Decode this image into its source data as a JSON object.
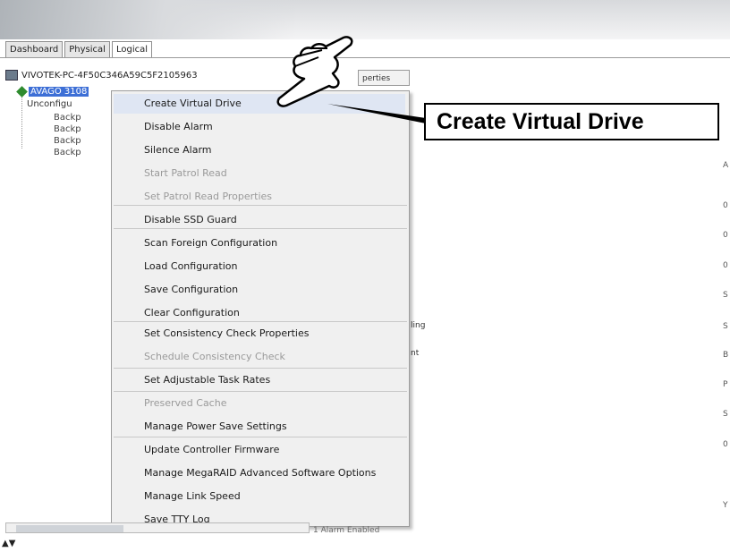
{
  "tabs": [
    "Dashboard",
    "Physical",
    "Logical"
  ],
  "tree": {
    "host": "VIVOTEK-PC-4F50C346A59C5F2105963",
    "selected_controller": "AVAGO 3108",
    "unconfigured": "Unconfigu",
    "backplanes": [
      "Backp",
      "Backp",
      "Backp",
      "Backp"
    ],
    "properties_tab": "perties"
  },
  "right_column": [
    "A",
    "0",
    "0",
    "0",
    "S",
    "S",
    "B",
    "P",
    "S",
    "0",
    "Y"
  ],
  "partial_labels": [
    "ling",
    "nt"
  ],
  "bottom_text": "1 Alarm Enabled",
  "menu": {
    "items": [
      {
        "label": "Create Virtual Drive",
        "enabled": true
      },
      {
        "label": "Disable Alarm",
        "enabled": true
      },
      {
        "label": "Silence Alarm",
        "enabled": true
      },
      {
        "label": "Start Patrol Read",
        "enabled": false
      },
      {
        "label": "Set Patrol Read Properties",
        "enabled": false
      },
      {
        "label": "Disable SSD Guard",
        "enabled": true
      },
      {
        "label": "Scan Foreign Configuration",
        "enabled": true
      },
      {
        "label": "Load Configuration",
        "enabled": true
      },
      {
        "label": "Save Configuration",
        "enabled": true
      },
      {
        "label": "Clear Configuration",
        "enabled": true
      },
      {
        "label": "Set Consistency Check Properties",
        "enabled": true
      },
      {
        "label": "Schedule Consistency Check",
        "enabled": false
      },
      {
        "label": "Set Adjustable Task Rates",
        "enabled": true
      },
      {
        "label": "Preserved Cache",
        "enabled": false
      },
      {
        "label": "Manage Power Save Settings",
        "enabled": true
      },
      {
        "label": "Update Controller Firmware",
        "enabled": true
      },
      {
        "label": "Manage MegaRAID Advanced Software Options",
        "enabled": true
      },
      {
        "label": "Manage Link Speed",
        "enabled": true
      },
      {
        "label": "Save TTY Log",
        "enabled": true
      }
    ]
  },
  "callout": {
    "text": "Create Virtual Drive"
  },
  "icons": {
    "hand": "pointing-hand-icon",
    "host": "computer-icon",
    "controller": "controller-icon"
  },
  "colors": {
    "selection": "#3d6fd6",
    "controller_icon": "#2e8b2e",
    "menu_bg": "#f0f0f0"
  }
}
